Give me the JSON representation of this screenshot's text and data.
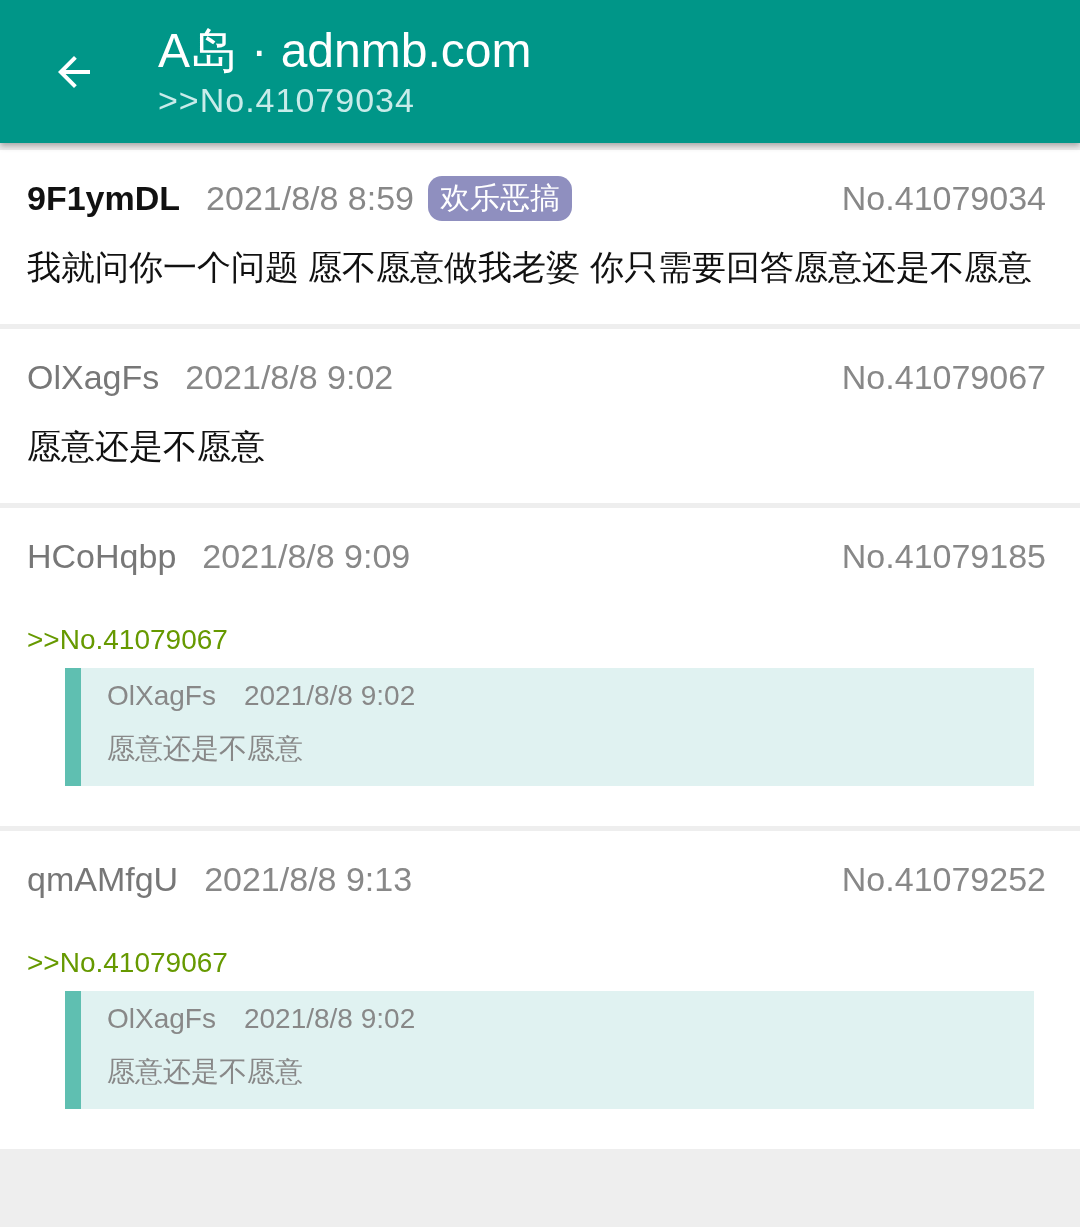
{
  "app_bar": {
    "title": "A岛 · adnmb.com",
    "subtitle": ">>No.41079034"
  },
  "posts": [
    {
      "kind": "op",
      "uid": "9F1ymDL",
      "time": "2021/8/8 8:59",
      "tag": "欢乐恶搞",
      "number": "No.41079034",
      "content": "我就问你一个问题 愿不愿意做我老婆 你只需要回答愿意还是不愿意"
    },
    {
      "kind": "reply",
      "uid": "OlXagFs",
      "time": "2021/8/8 9:02",
      "number": "No.41079067",
      "content": "愿意还是不愿意"
    },
    {
      "kind": "reply",
      "uid": "HCoHqbp",
      "time": "2021/8/8 9:09",
      "number": "No.41079185",
      "reference": ">>No.41079067",
      "quote": {
        "uid": "OlXagFs",
        "time": "2021/8/8 9:02",
        "content": "愿意还是不愿意"
      }
    },
    {
      "kind": "reply",
      "uid": "qmAMfgU",
      "time": "2021/8/8 9:13",
      "number": "No.41079252",
      "reference": ">>No.41079067",
      "quote": {
        "uid": "OlXagFs",
        "time": "2021/8/8 9:02",
        "content": "愿意还是不愿意"
      }
    }
  ]
}
